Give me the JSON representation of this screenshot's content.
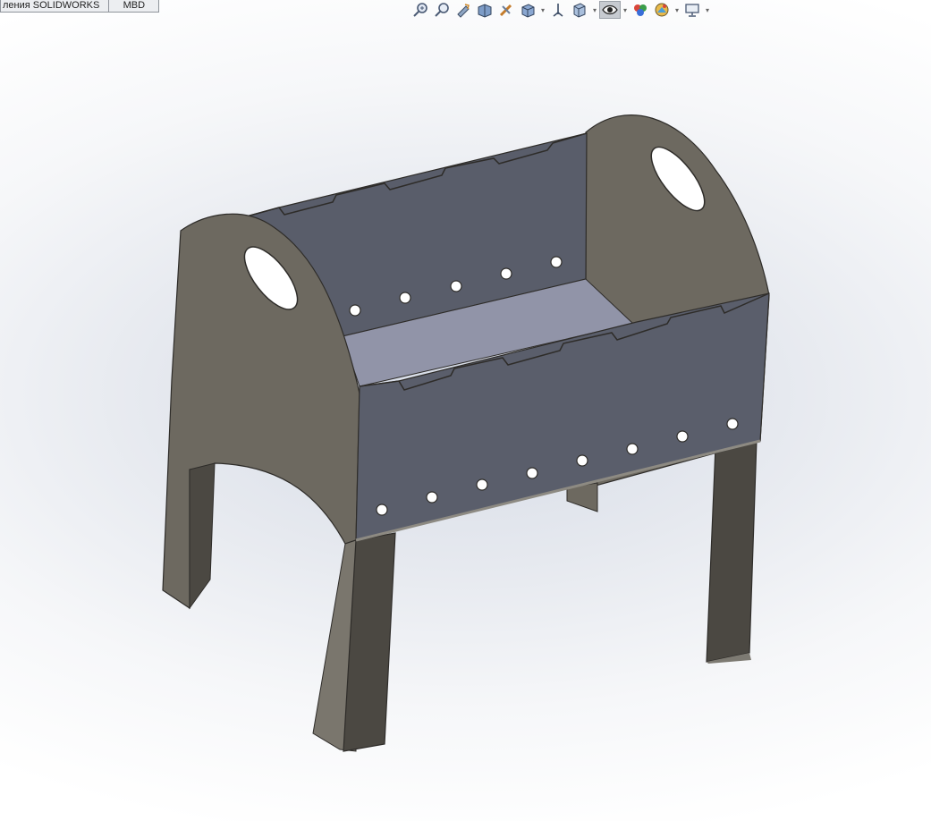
{
  "tabs": [
    {
      "label": "ления SOLIDWORKS"
    },
    {
      "label": "MBD"
    }
  ],
  "hud_toolbar": [
    {
      "icon": "zoom-to-fit-icon"
    },
    {
      "icon": "zoom-to-area-icon"
    },
    {
      "icon": "previous-view-icon"
    },
    {
      "icon": "section-view-icon"
    },
    {
      "icon": "dynamic-annotation-views-icon"
    },
    {
      "icon": "view-orientation-icon"
    },
    {
      "icon": "display-style-icon"
    },
    {
      "icon": "hide-show-items-icon"
    },
    {
      "icon": "edit-appearance-icon"
    },
    {
      "icon": "apply-scene-icon"
    },
    {
      "icon": "view-settings-icon"
    }
  ],
  "colors": {
    "panel_front": "#5a5e6b",
    "panel_back": "#595d6a",
    "floor": "#9194a8",
    "side": "#6d6960",
    "leg_dark": "#4b4842"
  }
}
